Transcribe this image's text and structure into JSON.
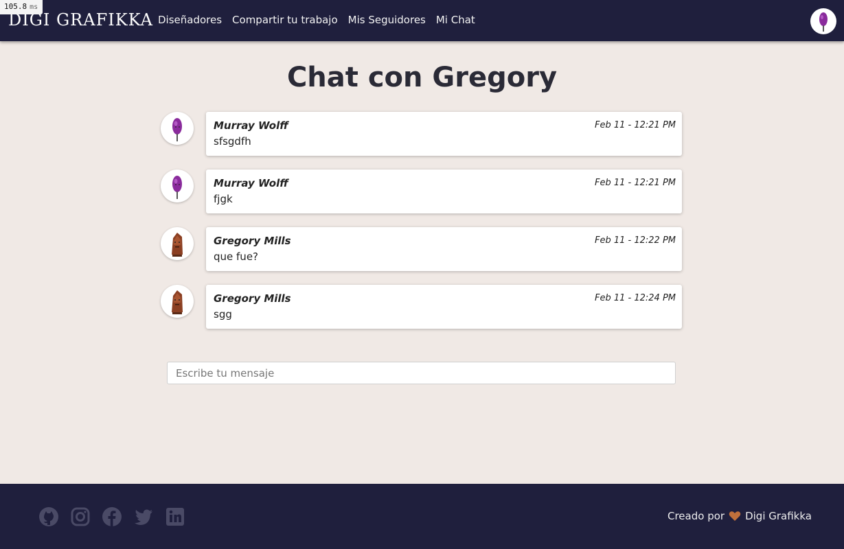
{
  "timing": {
    "value": "105.8",
    "unit": "ms"
  },
  "header": {
    "brand": "DIGI GRAFIKKA",
    "links": [
      {
        "label": "Diseñadores"
      },
      {
        "label": "Compartir tu trabajo"
      },
      {
        "label": "Mis Seguidores"
      },
      {
        "label": "Mi Chat"
      }
    ]
  },
  "chat": {
    "title": "Chat con Gregory",
    "messages": [
      {
        "author": "Murray Wolff",
        "time": "Feb 11 - 12:21 PM",
        "text": "sfsgdfh",
        "avatar": "purple-figure-avatar"
      },
      {
        "author": "Murray Wolff",
        "time": "Feb 11 - 12:21 PM",
        "text": "fjgk",
        "avatar": "purple-figure-avatar"
      },
      {
        "author": "Gregory Mills",
        "time": "Feb 11 - 12:22 PM",
        "text": "que fue?",
        "avatar": "brown-figure-avatar"
      },
      {
        "author": "Gregory Mills",
        "time": "Feb 11 - 12:24 PM",
        "text": "sgg",
        "avatar": "brown-figure-avatar"
      }
    ],
    "input": {
      "placeholder": "Escribe tu mensaje",
      "value": ""
    }
  },
  "footer": {
    "icons": [
      "github-icon",
      "instagram-icon",
      "facebook-icon",
      "twitter-icon",
      "linkedin-icon"
    ],
    "credit_prefix": "Creado por",
    "credit_name": "Digi Grafikka"
  },
  "colors": {
    "navbar": "#1f1f3d",
    "page_bg": "#f0e9e5",
    "footer": "#1f1f3d",
    "heart": "#c0703c",
    "social_icon": "#4a4a66"
  }
}
